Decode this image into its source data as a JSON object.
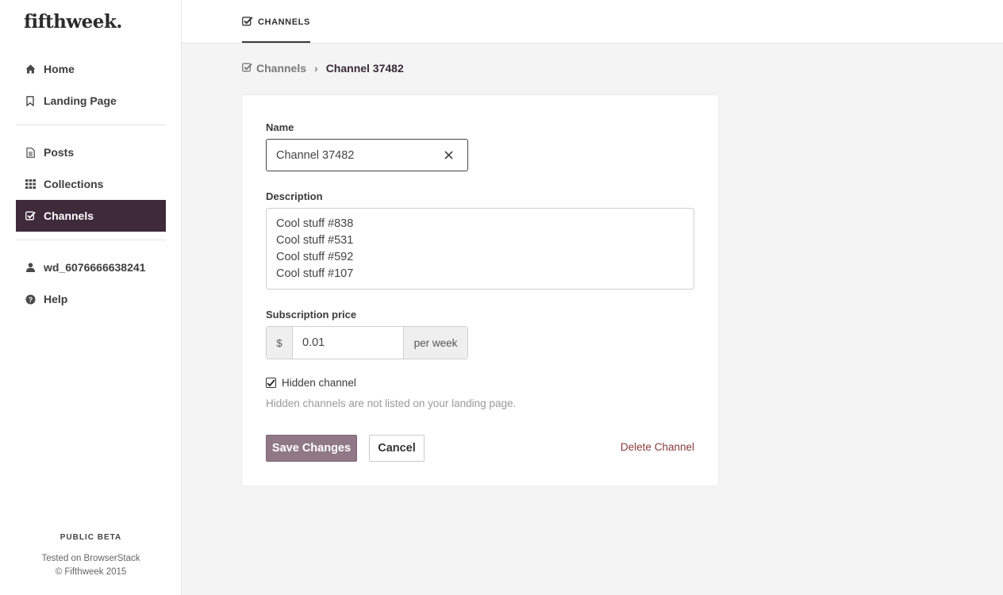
{
  "brand": {
    "logo": "fifthweek."
  },
  "sidebar": {
    "items": [
      {
        "label": "Home",
        "icon": "home-icon"
      },
      {
        "label": "Landing Page",
        "icon": "bookmark-icon"
      },
      {
        "label": "Posts",
        "icon": "document-icon"
      },
      {
        "label": "Collections",
        "icon": "grid-icon"
      },
      {
        "label": "Channels",
        "icon": "checkbox-icon",
        "active": true
      },
      {
        "label": "wd_6076666638241",
        "icon": "user-icon"
      },
      {
        "label": "Help",
        "icon": "question-icon"
      }
    ],
    "footer": {
      "beta": "PUBLIC BETA",
      "tested": "Tested on BrowserStack",
      "copyright": "© Fifthweek 2015"
    }
  },
  "topbar": {
    "tab_label": "CHANNELS"
  },
  "breadcrumb": {
    "parent": "Channels",
    "separator": "›",
    "current": "Channel 37482"
  },
  "form": {
    "name_label": "Name",
    "name_value": "Channel 37482",
    "description_label": "Description",
    "description_lines": [
      "Cool stuff #838",
      "Cool stuff #531",
      "Cool stuff #592",
      "Cool stuff #107"
    ],
    "price_label": "Subscription price",
    "price_prefix": "$",
    "price_value": "0.01",
    "price_suffix": "per week",
    "hidden_label": "Hidden channel",
    "hidden_checked": true,
    "hidden_help": "Hidden channels are not listed on your landing page.",
    "save_label": "Save Changes",
    "cancel_label": "Cancel",
    "delete_label": "Delete Channel"
  },
  "colors": {
    "accent": "#3f2a3a",
    "save_button": "#907887",
    "delete_link": "#8b3a3a",
    "main_bg": "#f4f4f4"
  }
}
